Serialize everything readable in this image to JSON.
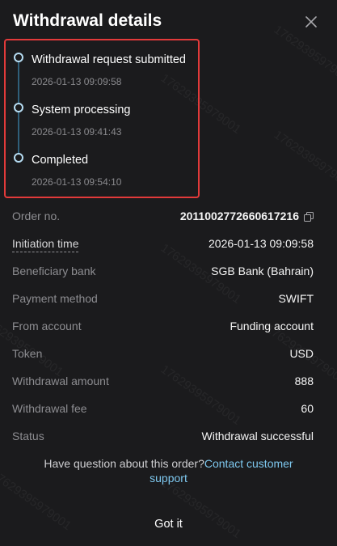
{
  "header": {
    "title": "Withdrawal details"
  },
  "watermark": "17629395979001",
  "timeline": [
    {
      "label": "Withdrawal request submitted",
      "time": "2026-01-13 09:09:58"
    },
    {
      "label": "System processing",
      "time": "2026-01-13 09:41:43"
    },
    {
      "label": "Completed",
      "time": "2026-01-13 09:54:10"
    }
  ],
  "details": {
    "order_no": {
      "label": "Order no.",
      "value": "2011002772660617216"
    },
    "initiation_time": {
      "label": "Initiation time",
      "value": "2026-01-13 09:09:58"
    },
    "beneficiary_bank": {
      "label": "Beneficiary bank",
      "value": "SGB Bank (Bahrain)"
    },
    "payment_method": {
      "label": "Payment method",
      "value": "SWIFT"
    },
    "from_account": {
      "label": "From account",
      "value": "Funding account"
    },
    "token": {
      "label": "Token",
      "value": "USD"
    },
    "withdrawal_amount": {
      "label": "Withdrawal amount",
      "value": "888"
    },
    "withdrawal_fee": {
      "label": "Withdrawal fee",
      "value": "60"
    },
    "status": {
      "label": "Status",
      "value": "Withdrawal successful"
    }
  },
  "help": {
    "question": "Have question about this order?",
    "link_line1": "Contact customer",
    "link_line2": "support"
  },
  "footer": {
    "got_it": "Got it"
  },
  "colors": {
    "background": "#1b1b1d",
    "accent": "#7ec8ef",
    "highlight_border": "#e23a3a",
    "muted": "#8d8d91"
  },
  "icons": {
    "close": "close-icon",
    "copy": "copy-icon"
  }
}
